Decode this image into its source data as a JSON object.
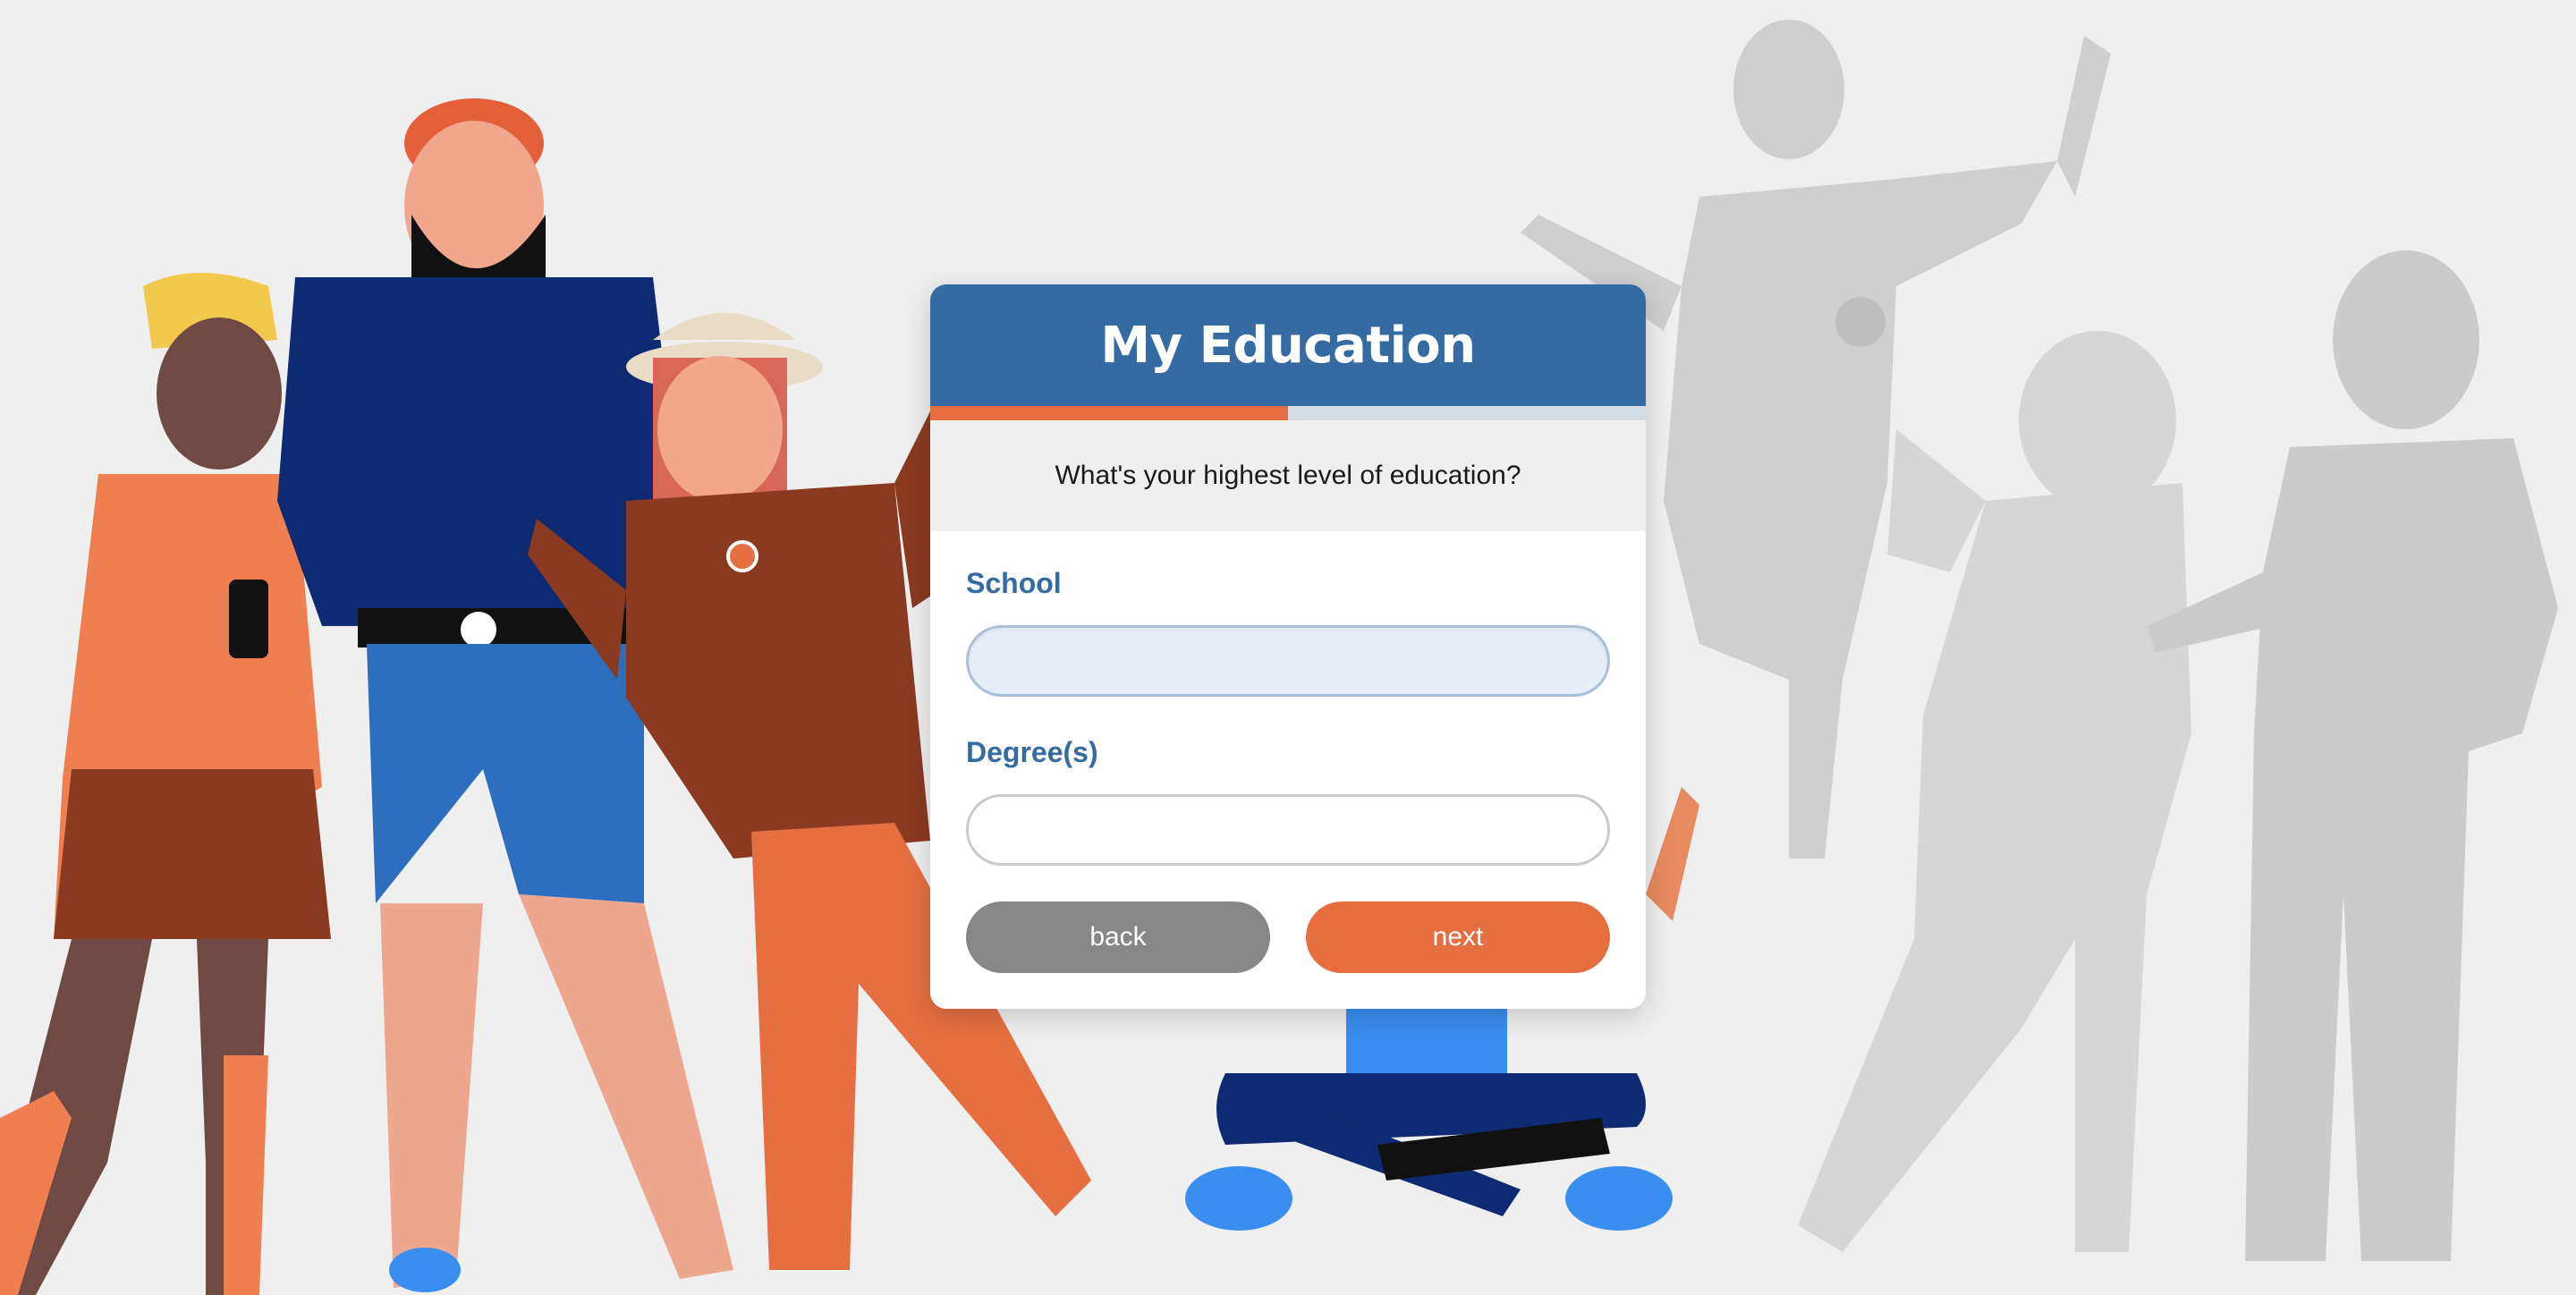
{
  "card": {
    "title": "My Education",
    "progress": 0.5,
    "question": "What's your highest level of education?"
  },
  "fields": {
    "school": {
      "label": "School",
      "value": "",
      "focused": true
    },
    "degrees": {
      "label": "Degree(s)",
      "value": ""
    }
  },
  "buttons": {
    "back": "back",
    "next": "next"
  },
  "colors": {
    "header": "#356ba3",
    "accent": "#e56f41",
    "back_button": "#878787",
    "background": "#efefef"
  }
}
